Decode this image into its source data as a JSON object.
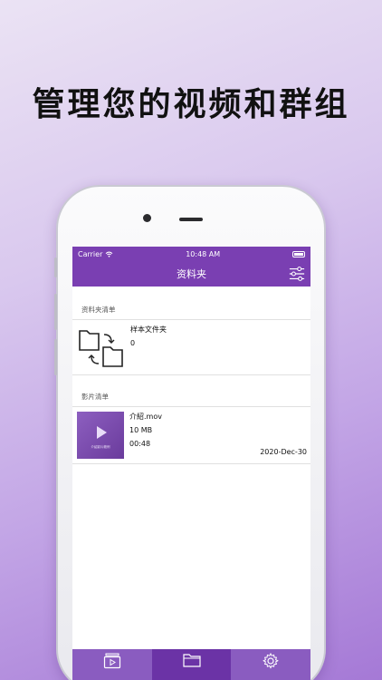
{
  "headline": "管理您的视频和群组",
  "status_bar": {
    "carrier": "Carrier",
    "time": "10:48 AM"
  },
  "nav": {
    "title": "资料夹"
  },
  "folders": {
    "header": "资料夹清单",
    "items": [
      {
        "name": "样本文件夹",
        "count": "0"
      }
    ]
  },
  "videos": {
    "header": "影片清单",
    "items": [
      {
        "title": "介紹.mov",
        "size": "10 MB",
        "duration": "00:48",
        "date": "2020-Dec-30",
        "thumb_caption": "介紹影片範例"
      }
    ]
  },
  "tabs": [
    {
      "icon": "video-library-icon",
      "active": false
    },
    {
      "icon": "folder-icon",
      "active": true
    },
    {
      "icon": "gear-icon",
      "active": false
    }
  ],
  "colors": {
    "primary": "#7a3fb2",
    "tab_bar": "#8a5cc0",
    "tab_active": "#6b33a6"
  }
}
